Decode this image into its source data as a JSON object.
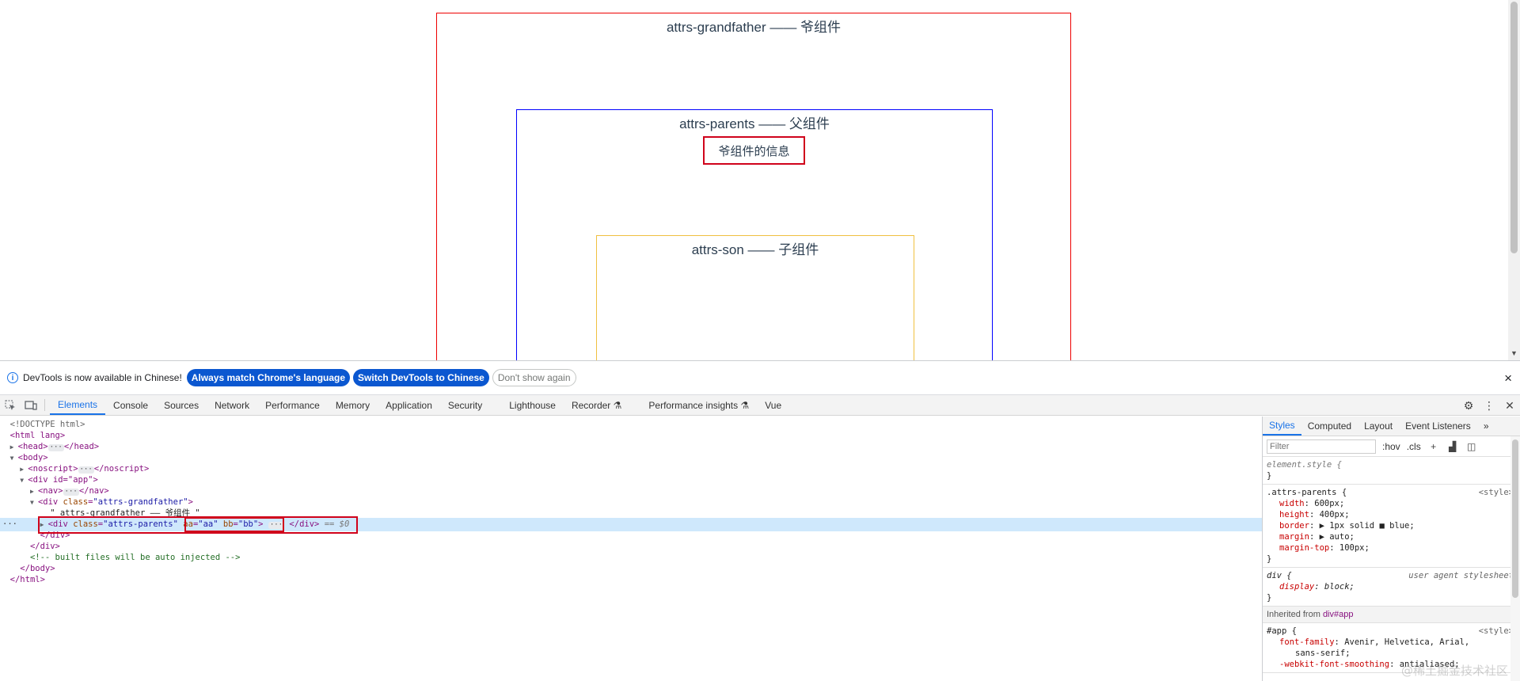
{
  "page": {
    "grandfather_title": "attrs-grandfather —— 爷组件",
    "parents_title": "attrs-parents —— 父组件",
    "info_box": "爷组件的信息",
    "son_title": "attrs-son —— 子组件"
  },
  "infobar": {
    "message": "DevTools is now available in Chinese!",
    "btn_match": "Always match Chrome's language",
    "btn_switch": "Switch DevTools to Chinese",
    "btn_dont_show": "Don't show again",
    "close": "×"
  },
  "tabs": [
    "Elements",
    "Console",
    "Sources",
    "Network",
    "Performance",
    "Memory",
    "Application",
    "Security",
    "Lighthouse",
    "Recorder ⚗",
    "Performance insights ⚗",
    "Vue"
  ],
  "elements_tree": {
    "doctype": "<!DOCTYPE html>",
    "html_open": "<html lang>",
    "head": "<head>",
    "head_close": "</head>",
    "body_open": "<body>",
    "noscript": "<noscript>",
    "noscript_close": "</noscript>",
    "div_app": "<div id=\"app\">",
    "nav": "<nav>",
    "nav_close": "</nav>",
    "div_gf_tag": "<div ",
    "div_gf_attr": "class",
    "div_gf_val": "\"attrs-grandfather\"",
    "gf_text": "\" attrs-grandfather —— 爷组件 \"",
    "sel_attr": "class",
    "sel_val": "\"attrs-parents\"",
    "sel_aa": "aa",
    "sel_aa_val": "\"aa\"",
    "sel_bb": "bb",
    "sel_bb_val": "\"bb\"",
    "sel_close": "</div>",
    "sel_marker": "== $0",
    "div_close_1": "</div>",
    "div_close_2": "</div>",
    "comment": "<!-- built files will be auto injected -->",
    "body_close": "</body>",
    "html_close": "</html>"
  },
  "styles_pane": {
    "tabs": [
      "Styles",
      "Computed",
      "Layout",
      "Event Listeners"
    ],
    "filter_placeholder": "Filter",
    "hov": ":hov",
    "cls": ".cls",
    "element_style": "element.style {",
    "close_brace": "}",
    "rule1_selector": ".attrs-parents {",
    "rule1_source": "<style>",
    "rule1_props": [
      {
        "name": "width",
        "value": "600px;"
      },
      {
        "name": "height",
        "value": "400px;"
      },
      {
        "name": "border",
        "value": "▶ 1px solid ■ blue;"
      },
      {
        "name": "margin",
        "value": "▶ auto;"
      },
      {
        "name": "margin-top",
        "value": "100px;"
      }
    ],
    "rule2_selector": "div {",
    "rule2_source": "user agent stylesheet",
    "rule2_prop_name": "display",
    "rule2_prop_value": "block;",
    "inherited_label": "Inherited from",
    "inherited_ref": "div#app",
    "rule3_selector": "#app {",
    "rule3_source": "<style>",
    "rule3_prop1_name": "font-family",
    "rule3_prop1_value": "Avenir, Helvetica, Arial,",
    "rule3_prop1_cont": "sans-serif;",
    "rule3_prop2_name": "-webkit-font-smoothing",
    "rule3_prop2_value": "antialiased;"
  },
  "watermark": "@稀土掘金技术社区"
}
